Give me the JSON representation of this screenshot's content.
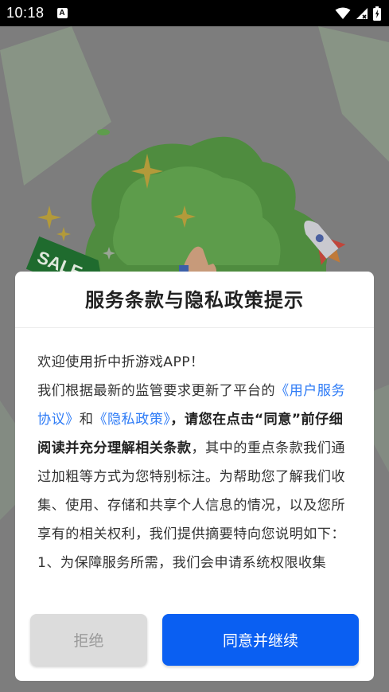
{
  "status_bar": {
    "time": "10:18",
    "notification_icon": "A",
    "icons": [
      "wifi-icon",
      "signal-icon",
      "battery-icon"
    ]
  },
  "background": {
    "sale_tag": "SALE",
    "colors": {
      "green": "#5fb14a",
      "dim_overlay": "#7d7d7d"
    }
  },
  "dialog": {
    "title": "服务条款与隐私政策提示",
    "body": {
      "p1": "欢迎使用折中折游戏APP！",
      "p2_start": "我们根据最新的监管要求更新了平台的",
      "link_user": "《用户服务协议》",
      "and": "和",
      "link_privacy": "《隐私政策》",
      "bold_text": "，请您在点击“同意”前仔细阅读并充分理解相关条款",
      "p2_end": "，其中的重点条款我们通过加粗等方式为您特别标注。为帮助您了解我们收集、使用、存储和共享个人信息的情况，以及您所享有的相关权利，我们提供摘要特向您说明如下：",
      "p3": "1、为保障服务所需，我们会申请系统权限收集"
    },
    "buttons": {
      "reject": "拒绝",
      "agree": "同意并继续"
    },
    "colors": {
      "agree_bg": "#0a5ff2",
      "reject_bg": "#dcdcdc",
      "link": "#2f7cf6"
    }
  }
}
